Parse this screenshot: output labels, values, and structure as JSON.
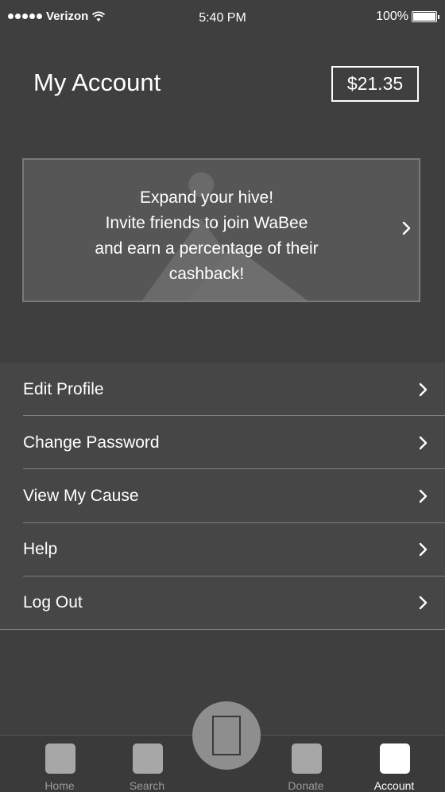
{
  "status_bar": {
    "carrier": "Verizon",
    "time": "5:40 PM",
    "battery": "100%"
  },
  "header": {
    "title": "My Account",
    "balance": "$21.35"
  },
  "invite_banner": {
    "line1": "Expand your hive!",
    "line2": "Invite friends to join WaBee",
    "line3": "and earn a percentage of their",
    "line4": "cashback!"
  },
  "menu": {
    "items": [
      {
        "label": "Edit Profile"
      },
      {
        "label": "Change Password"
      },
      {
        "label": "View My Cause"
      },
      {
        "label": "Help"
      },
      {
        "label": "Log Out"
      }
    ]
  },
  "tab_bar": {
    "tabs": [
      {
        "label": "Home"
      },
      {
        "label": "Search"
      },
      {
        "label": "Donate"
      },
      {
        "label": "Account"
      }
    ],
    "active": "Account"
  },
  "colors": {
    "background": "#3f3f3f",
    "menu_row": "#464646",
    "tab_icon": "#a7a7a7",
    "active_tab": "#ffffff"
  }
}
